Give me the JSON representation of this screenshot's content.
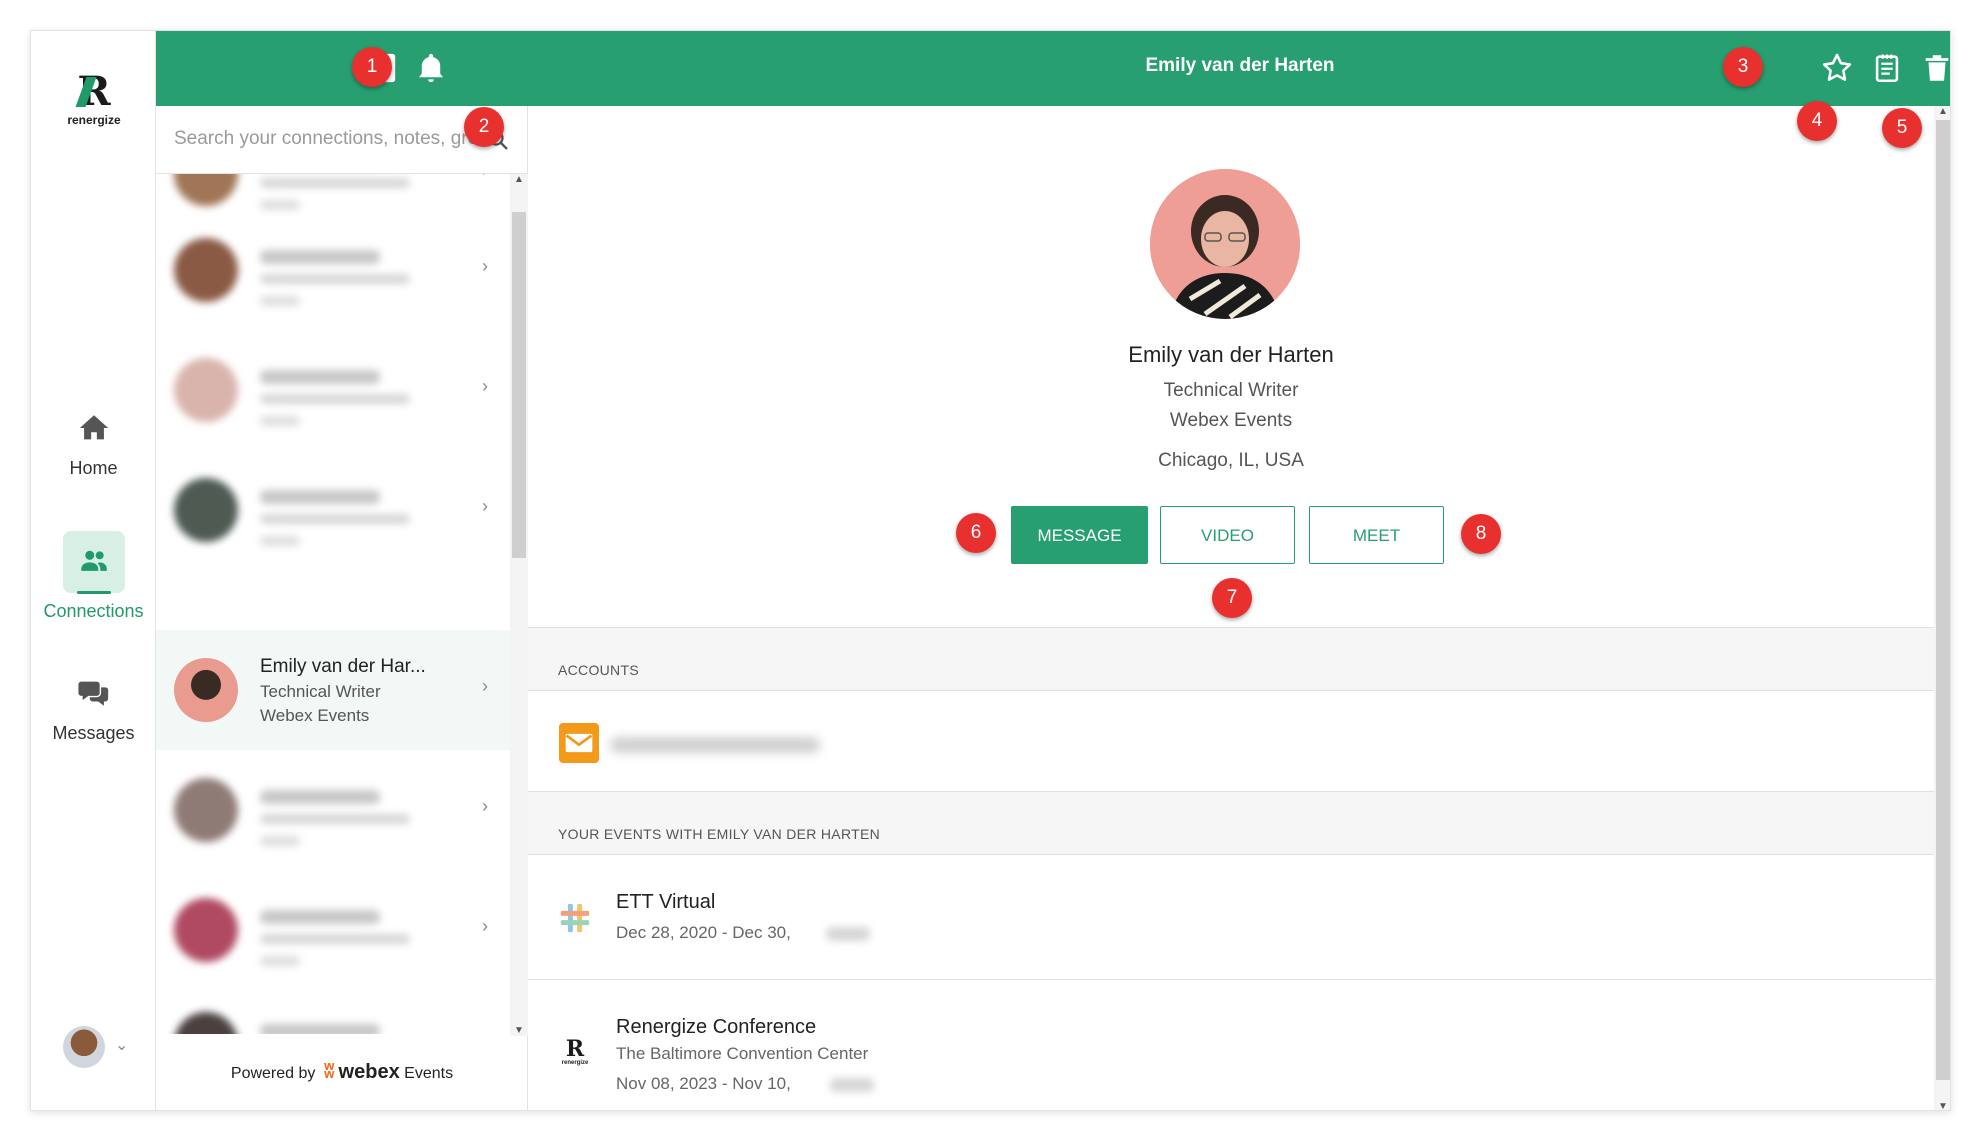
{
  "brand": {
    "logo_word": "renergize",
    "accent": "#279f70",
    "badge_color": "#e8302f"
  },
  "rail": {
    "items": [
      {
        "label": "Home",
        "icon": "home-icon"
      },
      {
        "label": "Connections",
        "icon": "people-icon",
        "active": true
      },
      {
        "label": "Messages",
        "icon": "chat-icon"
      }
    ]
  },
  "list": {
    "search_placeholder": "Search your connections, notes, groups...",
    "selected": {
      "name": "Emily van der Har...",
      "title": "Technical Writer",
      "company": "Webex Events"
    },
    "powered_by": "Powered by",
    "powered_brand": "webex",
    "powered_suffix": "Events"
  },
  "detail": {
    "header_title": "Emily van der Harten",
    "name": "Emily van der Harten",
    "title": "Technical Writer",
    "company": "Webex Events",
    "location": "Chicago, IL, USA",
    "buttons": {
      "message": "MESSAGE",
      "video": "VIDEO",
      "meet": "MEET"
    },
    "accounts_heading": "ACCOUNTS",
    "events_heading": "YOUR EVENTS WITH EMILY VAN DER HARTEN",
    "events": [
      {
        "name": "ETT Virtual",
        "dates": "Dec 28, 2020 - Dec 30,",
        "icon": "hash-icon"
      },
      {
        "name": "Renergize Conference",
        "venue": "The Baltimore Convention Center",
        "dates": "Nov 08, 2023 - Nov 10,",
        "icon": "renergize-logo-icon"
      }
    ]
  },
  "callouts": [
    "1",
    "2",
    "3",
    "4",
    "5",
    "6",
    "7",
    "8"
  ]
}
